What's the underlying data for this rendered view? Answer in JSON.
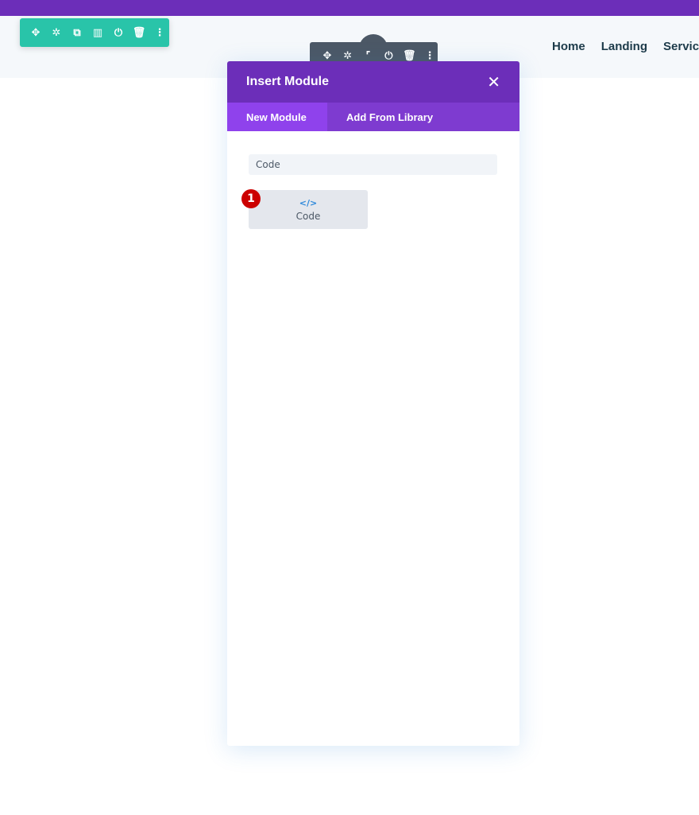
{
  "colors": {
    "top_bar": "#6c2eb9",
    "row_toolbar": "#29c4a9",
    "section_toolbar": "#4c5866",
    "modal_header": "#6c2eb9",
    "active_tab": "#8f42ec",
    "badge": "#cc0000"
  },
  "row_toolbar": {
    "icons": [
      "move-icon",
      "gear-icon",
      "duplicate-icon",
      "columns-icon",
      "power-icon",
      "trash-icon",
      "more-icon"
    ]
  },
  "module_toolbar": {
    "icons": [
      "move-icon",
      "gear-icon",
      "resize-icon",
      "power-icon",
      "trash-icon",
      "more-icon"
    ]
  },
  "nav": {
    "items": [
      "Home",
      "Landing",
      "Servic"
    ]
  },
  "modal": {
    "title": "Insert Module",
    "close_icon": "close-icon",
    "tabs": [
      {
        "label": "New Module",
        "active": true
      },
      {
        "label": "Add From Library",
        "active": false
      }
    ],
    "search_value": "Code",
    "modules": [
      {
        "icon": "code-icon",
        "icon_glyph": "</>",
        "label": "Code"
      }
    ],
    "step_badge": "1"
  }
}
